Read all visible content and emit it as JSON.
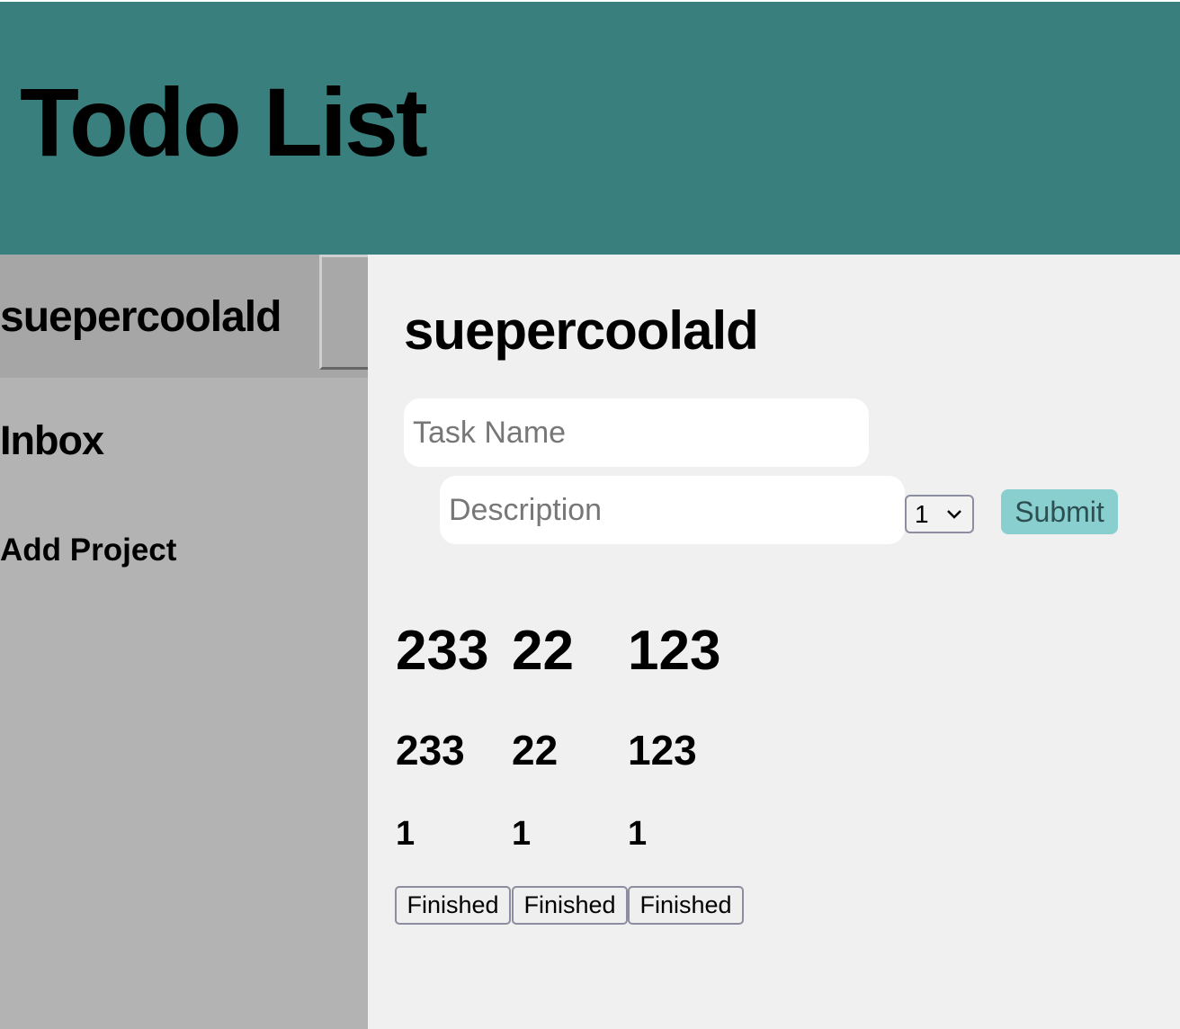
{
  "header": {
    "title": "Todo List"
  },
  "sidebar": {
    "project_name": "suepercoolald",
    "inbox_label": "Inbox",
    "add_project_label": "Add Project"
  },
  "main": {
    "title": "suepercoolald",
    "task_name_placeholder": "Task Name",
    "description_placeholder": "Description",
    "priority_value": "1",
    "submit_label": "Submit"
  },
  "tasks": [
    {
      "name": "233",
      "description": "233",
      "priority": "1",
      "button": "Finished"
    },
    {
      "name": "22",
      "description": "22",
      "priority": "1",
      "button": "Finished"
    },
    {
      "name": "123",
      "description": "123",
      "priority": "1",
      "button": "Finished"
    }
  ],
  "colors": {
    "header_bg": "#387f7d",
    "sidebar_bg": "#b3b3b3",
    "submit_bg": "#89cfcf"
  }
}
